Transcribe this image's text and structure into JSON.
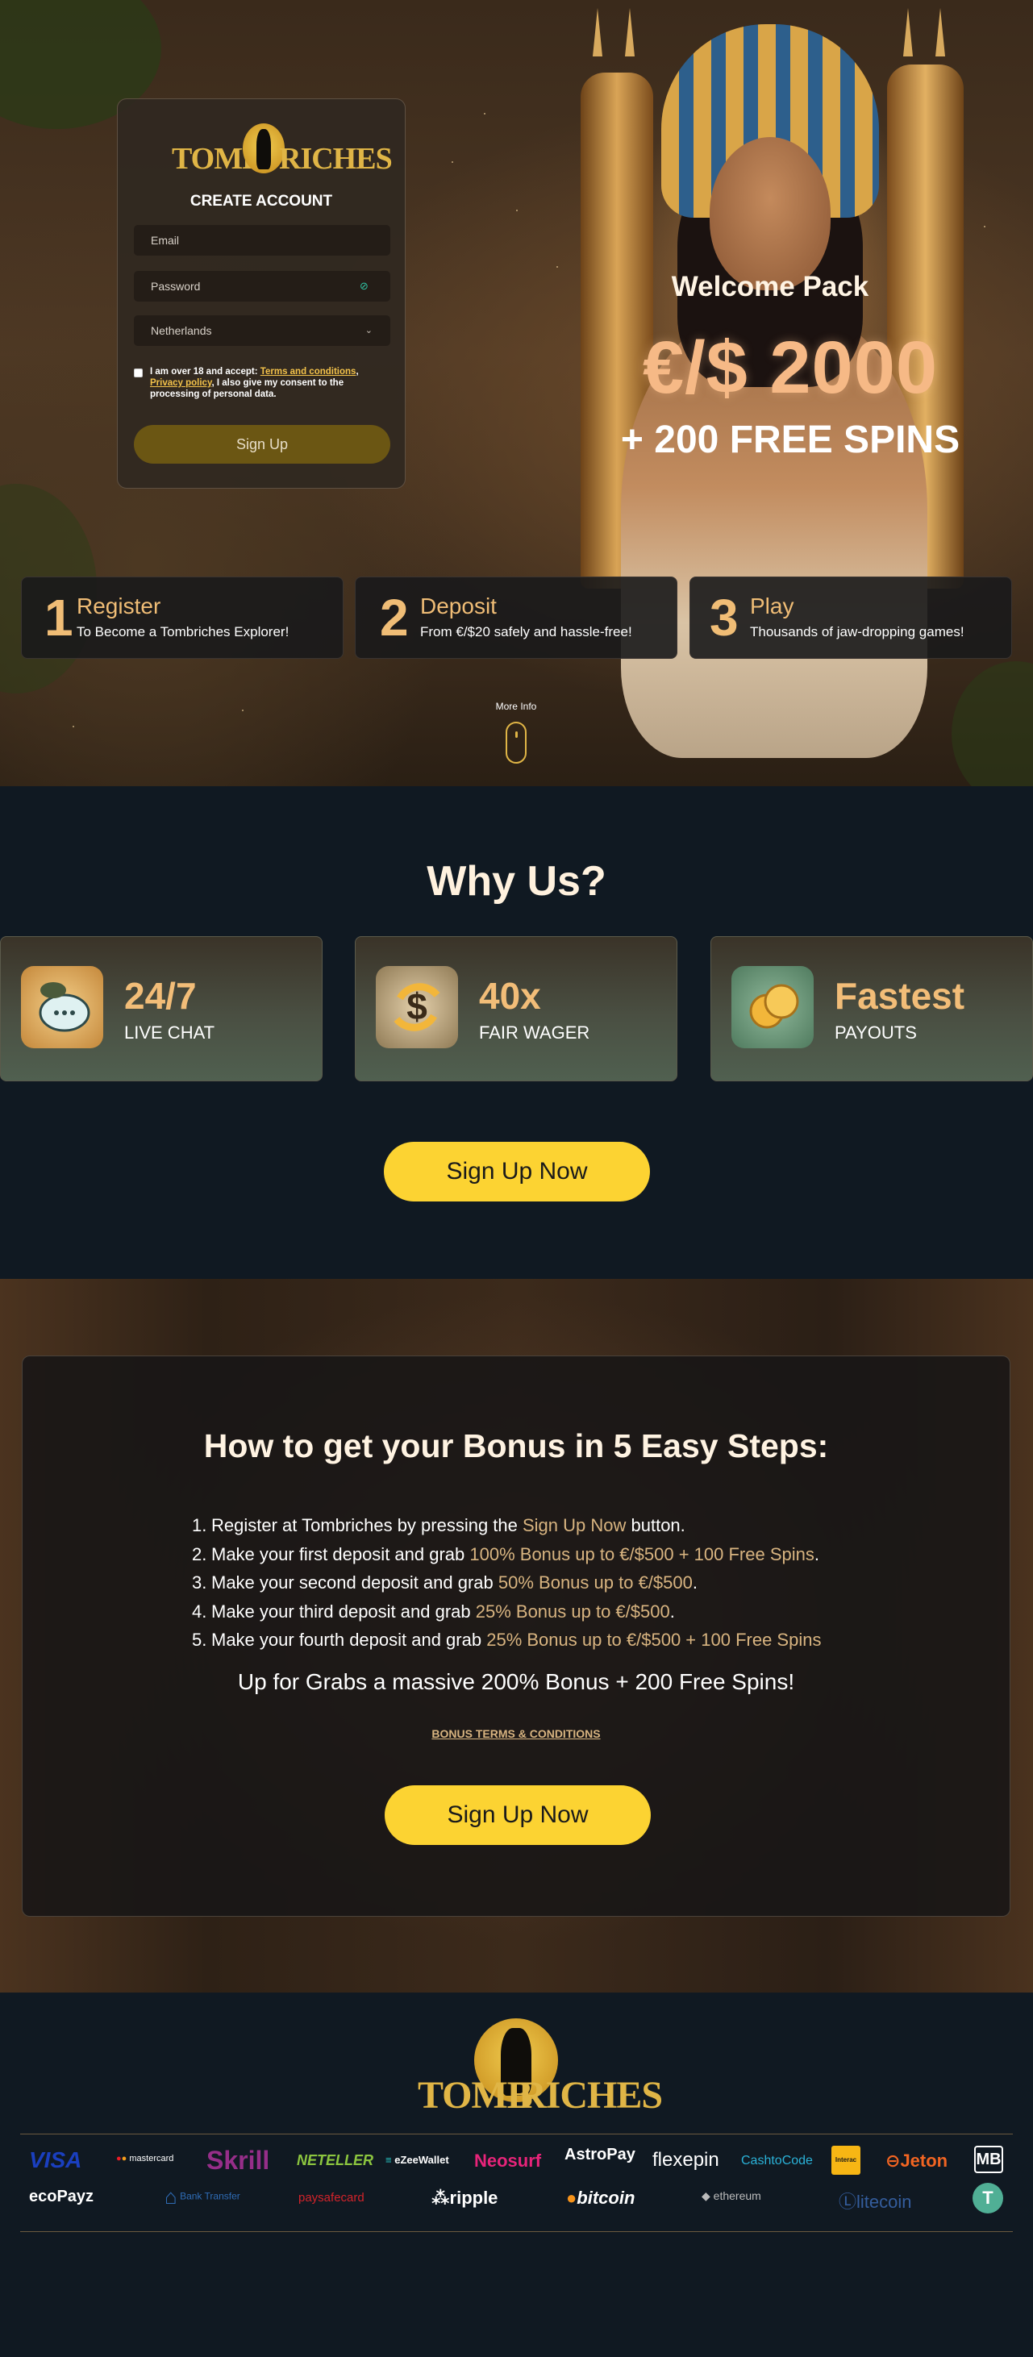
{
  "hero": {
    "signup": {
      "logo_left": "TOMB",
      "logo_right": "RICHES",
      "title": "CREATE ACCOUNT",
      "email_placeholder": "Email",
      "password_placeholder": "Password",
      "country": "Netherlands",
      "consent_prefix": "I am over 18 and accept: ",
      "terms_link": "Terms and conditions",
      "comma": ",",
      "privacy_link": "Privacy policy",
      "consent_suffix": ", I also give my consent to the processing of personal data.",
      "button": "Sign Up"
    },
    "welcome": "Welcome Pack",
    "amount": "€/$ 2000",
    "spins": "+ 200 FREE SPINS",
    "steps": [
      {
        "num": "1",
        "title": "Register",
        "sub": "To Become a Tombriches Explorer!"
      },
      {
        "num": "2",
        "title": "Deposit",
        "sub": "From €/$20 safely and hassle-free!"
      },
      {
        "num": "3",
        "title": "Play",
        "sub": "Thousands of jaw-dropping games!"
      }
    ],
    "more_info": "More Info"
  },
  "why": {
    "title": "Why Us?",
    "features": [
      {
        "big": "24/7",
        "small": "LIVE CHAT",
        "icon": "chat-bubble-icon"
      },
      {
        "big": "40x",
        "small": "FAIR WAGER",
        "icon": "dollar-arrows-icon"
      },
      {
        "big": "Fastest",
        "small": "PAYOUTS",
        "icon": "coins-icon"
      }
    ],
    "button": "Sign Up Now"
  },
  "bonus": {
    "title": "How to get your Bonus in 5 Easy Steps:",
    "steps": [
      {
        "n": "1.",
        "text": "Register at Tombriches by pressing the ",
        "hl": "Sign Up Now",
        "after": " button."
      },
      {
        "n": "2.",
        "text": "Make your first deposit and grab ",
        "hl": "100% Bonus up to €/$500 + 100 Free Spins",
        "after": "."
      },
      {
        "n": "3.",
        "text": "Make your second deposit and grab ",
        "hl": "50% Bonus up to €/$500",
        "after": "."
      },
      {
        "n": "4.",
        "text": "Make your third deposit and grab ",
        "hl": "25% Bonus up to €/$500",
        "after": "."
      },
      {
        "n": "5.",
        "text": "Make your fourth deposit and grab ",
        "hl": "25% Bonus up to €/$500 + 100 Free Spins",
        "after": ""
      }
    ],
    "grab": "Up for Grabs a massive 200% Bonus + 200 Free Spins!",
    "terms": "BONUS TERMS & CONDITIONS",
    "button": "Sign Up Now"
  },
  "footer": {
    "logo_left": "TOMB",
    "logo_right": "RICHES",
    "payments_row1": [
      "VISA",
      "mastercard",
      "Skrill",
      "NETELLER",
      "eZeeWallet",
      "Neosurf",
      "AstroPay",
      "flexepin",
      "CashtoCode",
      "Interac",
      "Jeton",
      "MB"
    ],
    "payments_row2": [
      "ecoPayz",
      "Bank Transfer",
      "paysafecard",
      "ripple",
      "bitcoin",
      "ethereum",
      "litecoin",
      "T"
    ]
  },
  "colors": {
    "accent_yellow": "#fcd332",
    "gold": "#e0b546",
    "peach": "#f0bd76",
    "dark_bg": "#101922"
  }
}
